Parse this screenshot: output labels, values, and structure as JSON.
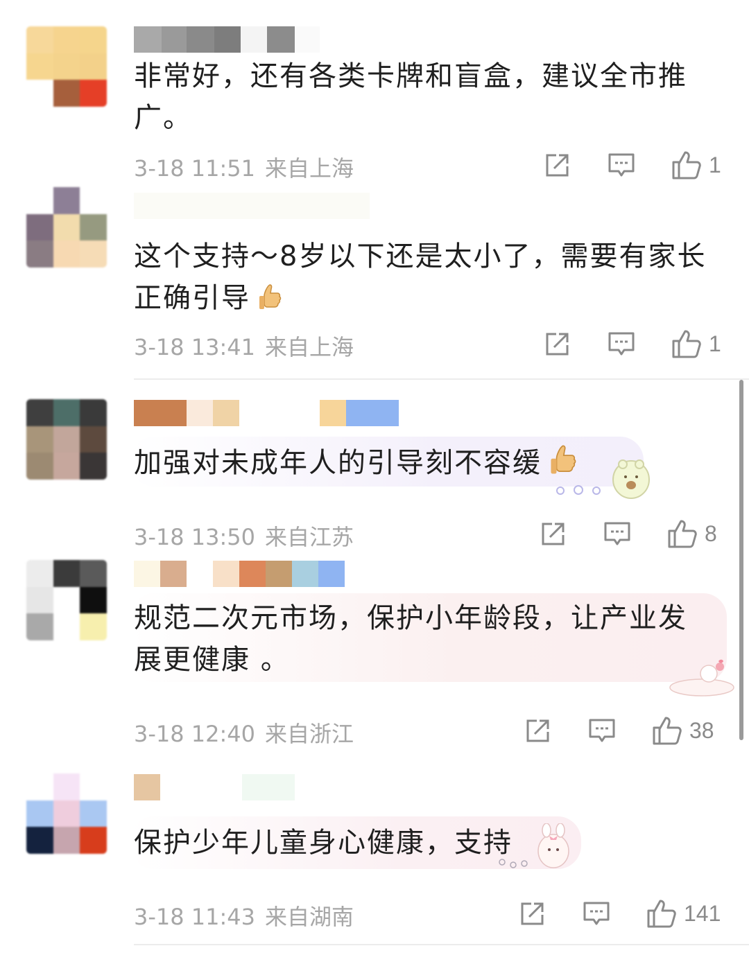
{
  "comments": [
    {
      "text": "非常好，还有各类卡牌和盲盒，建议全市推广。",
      "time": "3-18 11:51",
      "location": "来自上海",
      "likes": "1"
    },
    {
      "text": "这个支持～8岁以下还是太小了，需要有家长正确引导",
      "time": "3-18 13:41",
      "location": "来自上海",
      "likes": "1"
    },
    {
      "text": "加强对未成年人的引导刻不容缓",
      "time": "3-18 13:50",
      "location": "来自江苏",
      "likes": "8"
    },
    {
      "text": "规范二次元市场，保护小年龄段，让产业发展更健康 。",
      "time": "3-18 12:40",
      "location": "来自浙江",
      "likes": "38"
    },
    {
      "text": "保护少年儿童身心健康，支持",
      "time": "3-18 11:43",
      "location": "来自湖南",
      "likes": "141"
    }
  ],
  "icons": {
    "share": "share-icon",
    "reply": "comment-icon",
    "like": "thumbs-up-icon",
    "emoji": "thumbs-up-emoji"
  },
  "colors": {
    "meta": "#a6a6a6",
    "text": "#1f1f1f",
    "bubble_pink": "#fbeef0",
    "bubble_lavender": "#f3f0fb"
  }
}
